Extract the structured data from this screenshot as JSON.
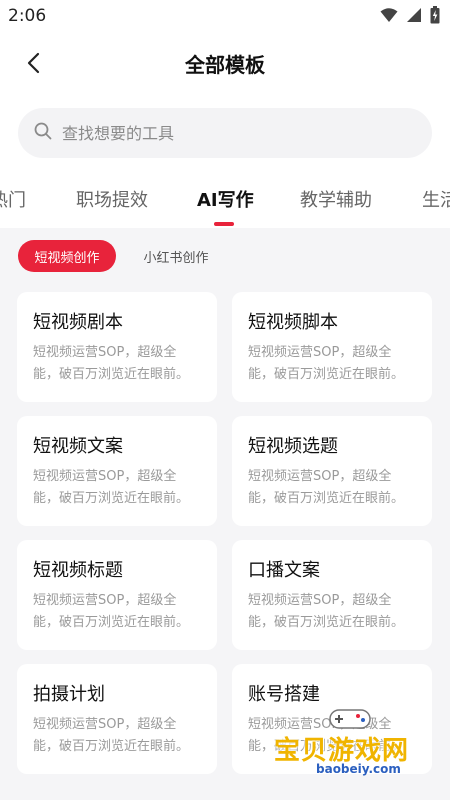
{
  "status": {
    "time": "2:06"
  },
  "header": {
    "title": "全部模板"
  },
  "search": {
    "placeholder": "查找想要的工具"
  },
  "category_tabs": [
    {
      "label": "热门"
    },
    {
      "label": "职场提效"
    },
    {
      "label": "AI写作",
      "active": true
    },
    {
      "label": "教学辅助"
    },
    {
      "label": "生活"
    }
  ],
  "sub_tabs": [
    {
      "label": "短视频创作",
      "active": true
    },
    {
      "label": "小红书创作"
    }
  ],
  "cards": [
    {
      "title": "短视频剧本",
      "desc_line1": "短视频运营SOP，超级全",
      "desc_line2": "能，破百万浏览近在眼前。"
    },
    {
      "title": "短视频脚本",
      "desc_line1": "短视频运营SOP，超级全",
      "desc_line2": "能，破百万浏览近在眼前。"
    },
    {
      "title": "短视频文案",
      "desc_line1": "短视频运营SOP，超级全",
      "desc_line2": "能，破百万浏览近在眼前。"
    },
    {
      "title": "短视频选题",
      "desc_line1": "短视频运营SOP，超级全",
      "desc_line2": "能，破百万浏览近在眼前。"
    },
    {
      "title": "短视频标题",
      "desc_line1": "短视频运营SOP，超级全",
      "desc_line2": "能，破百万浏览近在眼前。"
    },
    {
      "title": "口播文案",
      "desc_line1": "短视频运营SOP，超级全",
      "desc_line2": "能，破百万浏览近在眼前。"
    },
    {
      "title": "拍摄计划",
      "desc_line1": "短视频运营SOP，超级全",
      "desc_line2": "能，破百万浏览近在眼前。"
    },
    {
      "title": "账号搭建",
      "desc_line1": "短视频运营SOP，超级全",
      "desc_line2": "能，破百万浏览近在眼前。"
    }
  ],
  "watermark": {
    "text": "宝贝游戏网",
    "url": "baobeiy.com"
  },
  "colors": {
    "accent": "#e8233b",
    "background": "#f5f5f7",
    "card": "#ffffff"
  }
}
